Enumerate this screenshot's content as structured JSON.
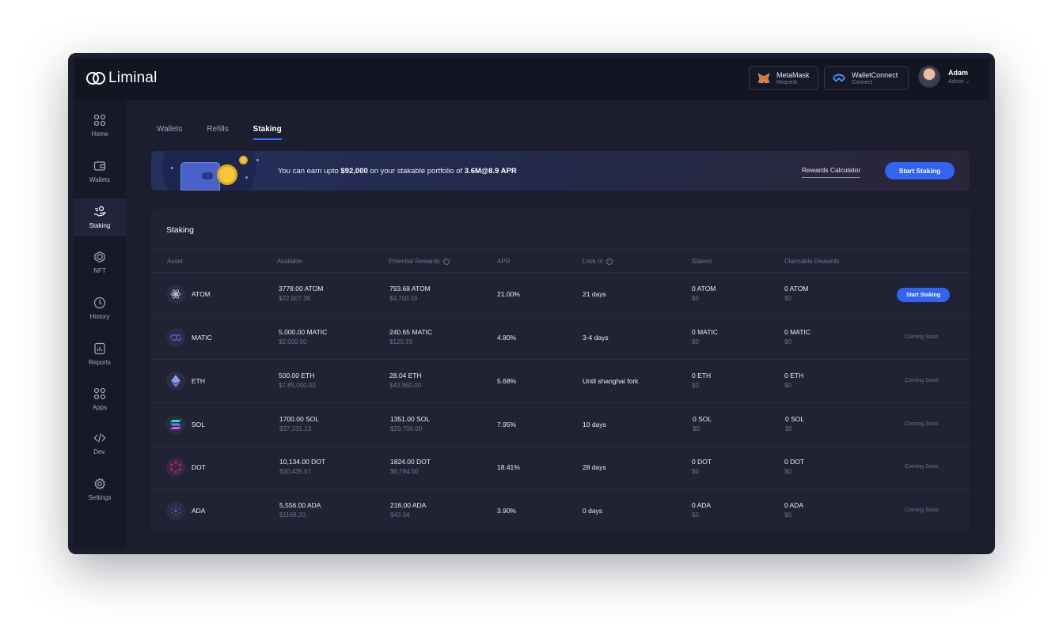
{
  "app": {
    "logo_text": "Liminal"
  },
  "header": {
    "metamask": {
      "title": "MetaMask",
      "subtitle": "Request"
    },
    "walletconnect": {
      "title": "WalletConnect",
      "subtitle": "Connect"
    },
    "user": {
      "name": "Adam",
      "role": "Admin"
    }
  },
  "sidebar": {
    "items": [
      {
        "label": "Home",
        "icon": "home-icon"
      },
      {
        "label": "Wallets",
        "icon": "wallet-icon"
      },
      {
        "label": "Staking",
        "icon": "staking-icon",
        "active": true
      },
      {
        "label": "NFT",
        "icon": "nft-icon"
      },
      {
        "label": "History",
        "icon": "history-icon"
      },
      {
        "label": "Reports",
        "icon": "reports-icon"
      },
      {
        "label": "Apps",
        "icon": "apps-icon"
      },
      {
        "label": "Dev.",
        "icon": "code-icon"
      },
      {
        "label": "Settings",
        "icon": "gear-icon"
      }
    ]
  },
  "tabs": [
    {
      "label": "Wallets"
    },
    {
      "label": "Refills"
    },
    {
      "label": "Staking",
      "active": true
    }
  ],
  "banner": {
    "text_prefix": "You can earn upto ",
    "amount": "$92,000",
    "text_middle": " on your stakable portfolio of ",
    "portfolio": "3.6M@8.9 APR",
    "calculator_label": "Rewards Calculator",
    "cta_label": "Start Staking"
  },
  "table": {
    "title": "Staking",
    "columns": [
      "Asset",
      "Available",
      "Potential Rewards",
      "APR",
      "Lock In",
      "Staked",
      "Claimable Rewards"
    ],
    "rows": [
      {
        "asset": "ATOM",
        "available": "3778.00 ATOM",
        "available_usd": "$22,907.38",
        "rewards": "793.68 ATOM",
        "rewards_usd": "$4,700.16",
        "apr": "21.00%",
        "lock_in": "21 days",
        "staked": "0 ATOM",
        "staked_usd": "$0",
        "claimable": "0 ATOM",
        "claimable_usd": "$0",
        "action": "Start Staking",
        "action_type": "button"
      },
      {
        "asset": "MATIC",
        "available": "5,000.00 MATIC",
        "available_usd": "$2,500.00",
        "rewards": "240.65 MATIC",
        "rewards_usd": "$120.33",
        "apr": "4.80%",
        "lock_in": "3-4 days",
        "staked": "0 MATIC",
        "staked_usd": "$0",
        "claimable": "0 MATIC",
        "claimable_usd": "$0",
        "action": "Coming Soon",
        "action_type": "text"
      },
      {
        "asset": "ETH",
        "available": "500.00 ETH",
        "available_usd": "$7,85,000.00",
        "rewards": "28.04 ETH",
        "rewards_usd": "$43,960.00",
        "apr": "5.68%",
        "lock_in": "Until shanghai fork",
        "staked": "0 ETH",
        "staked_usd": "$0",
        "claimable": "0 ETH",
        "claimable_usd": "$0",
        "action": "Coming Soon",
        "action_type": "text"
      },
      {
        "asset": "SOL",
        "available": "1700.00 SOL",
        "available_usd": "$37,331.13",
        "rewards": "1351.00 SOL",
        "rewards_usd": "$29,700.00",
        "apr": "7.95%",
        "lock_in": "10 days",
        "staked": "0 SOL",
        "staked_usd": "$0",
        "claimable": "0 SOL",
        "claimable_usd": "$0",
        "action": "Coming Soon",
        "action_type": "text"
      },
      {
        "asset": "DOT",
        "available": "10,134.00 DOT",
        "available_usd": "$30,435.67",
        "rewards": "1824.00 DOT",
        "rewards_usd": "$6,794.00",
        "apr": "18.41%",
        "lock_in": "28 days",
        "staked": "0 DOT",
        "staked_usd": "$0",
        "claimable": "0 DOT",
        "claimable_usd": "$0",
        "action": "Coming Soon",
        "action_type": "text"
      },
      {
        "asset": "ADA",
        "available": "5,556.00 ADA",
        "available_usd": "$1168.20",
        "rewards": "216.00 ADA",
        "rewards_usd": "$43.04",
        "apr": "3.90%",
        "lock_in": "0 days",
        "staked": "0 ADA",
        "staked_usd": "$0",
        "claimable": "0 ADA",
        "claimable_usd": "$0",
        "action": "Coming Soon",
        "action_type": "text"
      }
    ]
  },
  "colors": {
    "accent": "#2f64f5",
    "background": "#1c1d2e",
    "card": "#212233"
  }
}
